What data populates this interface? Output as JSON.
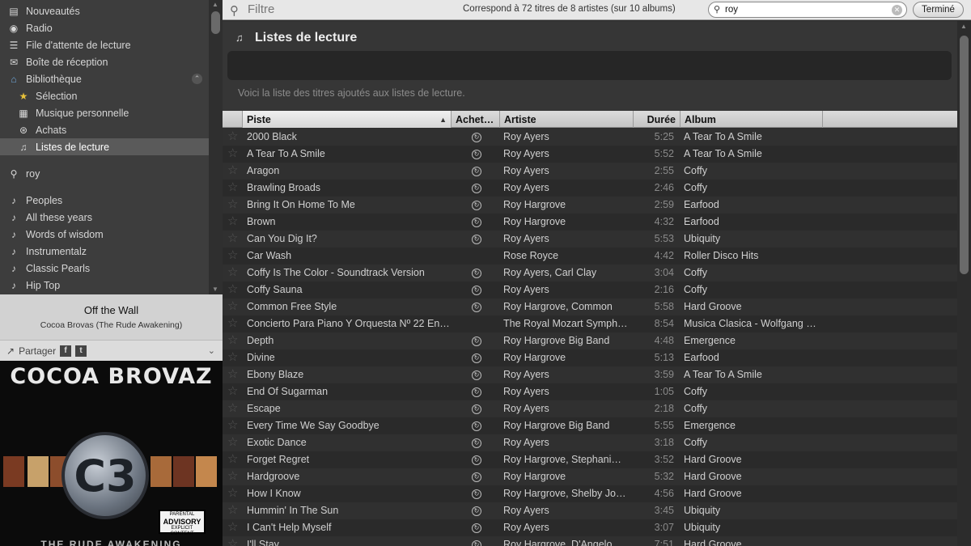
{
  "sidebar": {
    "items": [
      {
        "label": "Nouveautés",
        "icon": "news-icon"
      },
      {
        "label": "Radio",
        "icon": "radio-icon"
      },
      {
        "label": "File d'attente de lecture",
        "icon": "queue-icon"
      },
      {
        "label": "Boîte de réception",
        "icon": "inbox-icon"
      },
      {
        "label": "Bibliothèque",
        "icon": "library-icon"
      },
      {
        "label": "Sélection",
        "icon": "star-icon"
      },
      {
        "label": "Musique personnelle",
        "icon": "local-file-icon"
      },
      {
        "label": "Achats",
        "icon": "purchase-icon"
      },
      {
        "label": "Listes de lecture",
        "icon": "playlist-icon"
      },
      {
        "label": "roy",
        "icon": "search-icon"
      },
      {
        "label": "Peoples",
        "icon": "note-icon"
      },
      {
        "label": "All these years",
        "icon": "note-icon"
      },
      {
        "label": "Words of wisdom",
        "icon": "note-icon"
      },
      {
        "label": "Instrumentalz",
        "icon": "note-icon"
      },
      {
        "label": "Classic Pearls",
        "icon": "note-icon"
      },
      {
        "label": "Hip Top",
        "icon": "note-icon"
      }
    ],
    "selected": "Listes de lecture"
  },
  "now_playing": {
    "title": "Off the Wall",
    "subtitle": "Cocoa Brovas (The Rude Awakening)"
  },
  "share": {
    "label": "Partager"
  },
  "album_art": {
    "title": "COCOA BROVAZ",
    "logo_text": "C3",
    "advisory": {
      "line1": "PARENTAL",
      "line2": "ADVISORY",
      "line3": "EXPLICIT CONTENT"
    },
    "bottom_text": "THE RUDE AWAKENING"
  },
  "topbar": {
    "filter_label": "Filtre",
    "match_text": "Correspond à 72 titres de 8 artistes (sur 10 albums)",
    "search_value": "roy",
    "done_label": "Terminé"
  },
  "header": {
    "title": "Listes de lecture",
    "description": "Voici la liste des titres ajoutés aux listes de lecture."
  },
  "columns": {
    "track": "Piste",
    "purchased": "Achet…",
    "artist": "Artiste",
    "duration": "Durée",
    "album": "Album"
  },
  "tracks": [
    {
      "track": "2000 Black",
      "bought": true,
      "artist": "Roy Ayers",
      "duration": "5:25",
      "album": "A Tear To A Smile"
    },
    {
      "track": "A Tear To A Smile",
      "bought": true,
      "artist": "Roy Ayers",
      "duration": "5:52",
      "album": "A Tear To A Smile"
    },
    {
      "track": "Aragon",
      "bought": true,
      "artist": "Roy Ayers",
      "duration": "2:55",
      "album": "Coffy"
    },
    {
      "track": "Brawling Broads",
      "bought": true,
      "artist": "Roy Ayers",
      "duration": "2:46",
      "album": "Coffy"
    },
    {
      "track": "Bring It On Home To Me",
      "bought": true,
      "artist": "Roy Hargrove",
      "duration": "2:59",
      "album": "Earfood"
    },
    {
      "track": "Brown",
      "bought": true,
      "artist": "Roy Hargrove",
      "duration": "4:32",
      "album": "Earfood"
    },
    {
      "track": "Can You Dig It?",
      "bought": true,
      "artist": "Roy Ayers",
      "duration": "5:53",
      "album": "Ubiquity"
    },
    {
      "track": "Car Wash",
      "bought": false,
      "artist": "Rose Royce",
      "duration": "4:42",
      "album": "Roller Disco Hits"
    },
    {
      "track": "Coffy Is The Color - Soundtrack Version",
      "bought": true,
      "artist": "Roy Ayers, Carl Clay",
      "duration": "3:04",
      "album": "Coffy"
    },
    {
      "track": "Coffy Sauna",
      "bought": true,
      "artist": "Roy Ayers",
      "duration": "2:16",
      "album": "Coffy"
    },
    {
      "track": "Common Free Style",
      "bought": true,
      "artist": "Roy Hargrove, Common",
      "duration": "5:58",
      "album": "Hard Groove"
    },
    {
      "track": "Concierto Para Piano Y Orquesta Nº 22 En…",
      "bought": false,
      "artist": "The Royal Mozart Symph…",
      "duration": "8:54",
      "album": "Musica Clasica - Wolfgang …"
    },
    {
      "track": "Depth",
      "bought": true,
      "artist": "Roy Hargrove Big Band",
      "duration": "4:48",
      "album": "Emergence"
    },
    {
      "track": "Divine",
      "bought": true,
      "artist": "Roy Hargrove",
      "duration": "5:13",
      "album": "Earfood"
    },
    {
      "track": "Ebony Blaze",
      "bought": true,
      "artist": "Roy Ayers",
      "duration": "3:59",
      "album": "A Tear To A Smile"
    },
    {
      "track": "End Of Sugarman",
      "bought": true,
      "artist": "Roy Ayers",
      "duration": "1:05",
      "album": "Coffy"
    },
    {
      "track": "Escape",
      "bought": true,
      "artist": "Roy Ayers",
      "duration": "2:18",
      "album": "Coffy"
    },
    {
      "track": "Every Time We Say Goodbye",
      "bought": true,
      "artist": "Roy Hargrove Big Band",
      "duration": "5:55",
      "album": "Emergence"
    },
    {
      "track": "Exotic Dance",
      "bought": true,
      "artist": "Roy Ayers",
      "duration": "3:18",
      "album": "Coffy"
    },
    {
      "track": "Forget Regret",
      "bought": true,
      "artist": "Roy Hargrove, Stephani…",
      "duration": "3:52",
      "album": "Hard Groove"
    },
    {
      "track": "Hardgroove",
      "bought": true,
      "artist": "Roy Hargrove",
      "duration": "5:32",
      "album": "Hard Groove"
    },
    {
      "track": "How I Know",
      "bought": true,
      "artist": "Roy Hargrove, Shelby Jo…",
      "duration": "4:56",
      "album": "Hard Groove"
    },
    {
      "track": "Hummin' In The Sun",
      "bought": true,
      "artist": "Roy Ayers",
      "duration": "3:45",
      "album": "Ubiquity"
    },
    {
      "track": "I Can't Help Myself",
      "bought": true,
      "artist": "Roy Ayers",
      "duration": "3:07",
      "album": "Ubiquity"
    },
    {
      "track": "I'll Stay",
      "bought": true,
      "artist": "Roy Hargrove, D'Angelo",
      "duration": "7:51",
      "album": "Hard Groove"
    }
  ],
  "colors": {
    "background": "#2b2b2b",
    "sidebar": "#3d3d3d",
    "selected": "#5a5a5a",
    "header_bar": "#dcdcdc"
  }
}
